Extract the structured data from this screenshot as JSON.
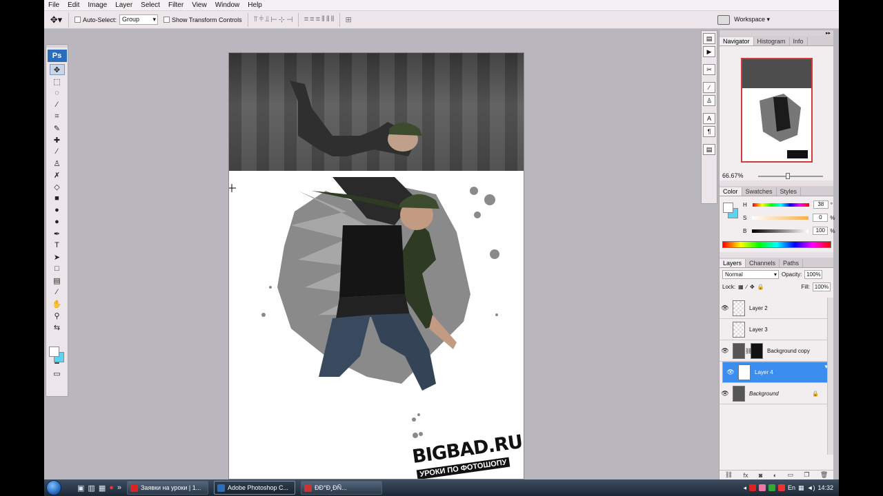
{
  "menu": [
    "File",
    "Edit",
    "Image",
    "Layer",
    "Select",
    "Filter",
    "View",
    "Window",
    "Help"
  ],
  "options": {
    "auto_select_label": "Auto-Select:",
    "auto_select_value": "Group",
    "transform_label": "Show Transform Controls",
    "workspace_label": "Workspace ▾"
  },
  "toolbox": {
    "logo": "Ps"
  },
  "canvas": {
    "brand": "BIGBAD.RU",
    "brand_sub": "УРОКИ ПО ФОТОШОПУ"
  },
  "navigator": {
    "tabs": [
      "Navigator",
      "Histogram",
      "Info"
    ],
    "zoom": "66.67%"
  },
  "color": {
    "tabs": [
      "Color",
      "Swatches",
      "Styles"
    ],
    "h_label": "H",
    "h_value": "38",
    "h_unit": "°",
    "s_label": "S",
    "s_value": "0",
    "s_unit": "%",
    "b_label": "B",
    "b_value": "100",
    "b_unit": "%"
  },
  "layers": {
    "tabs": [
      "Layers",
      "Channels",
      "Paths"
    ],
    "blend_mode": "Normal",
    "opacity_label": "Opacity:",
    "opacity_value": "100%",
    "lock_label": "Lock:",
    "fill_label": "Fill:",
    "fill_value": "100%",
    "rows": [
      {
        "name": "Layer 2"
      },
      {
        "name": "Layer 3"
      },
      {
        "name": "Background copy"
      },
      {
        "name": "Layer 4"
      },
      {
        "name": "Background"
      }
    ]
  },
  "taskbar": {
    "items": [
      "Заявки на уроки | 1...",
      "Adobe Photoshop C...",
      "ÐÐ°Ð¸ÐÑ..."
    ],
    "lang": "En",
    "time": "14:32"
  },
  "colors": {
    "selection": "#3c8df0",
    "ps_blue": "#2a6dbd",
    "bg_swatch": "#5ad4f0"
  }
}
